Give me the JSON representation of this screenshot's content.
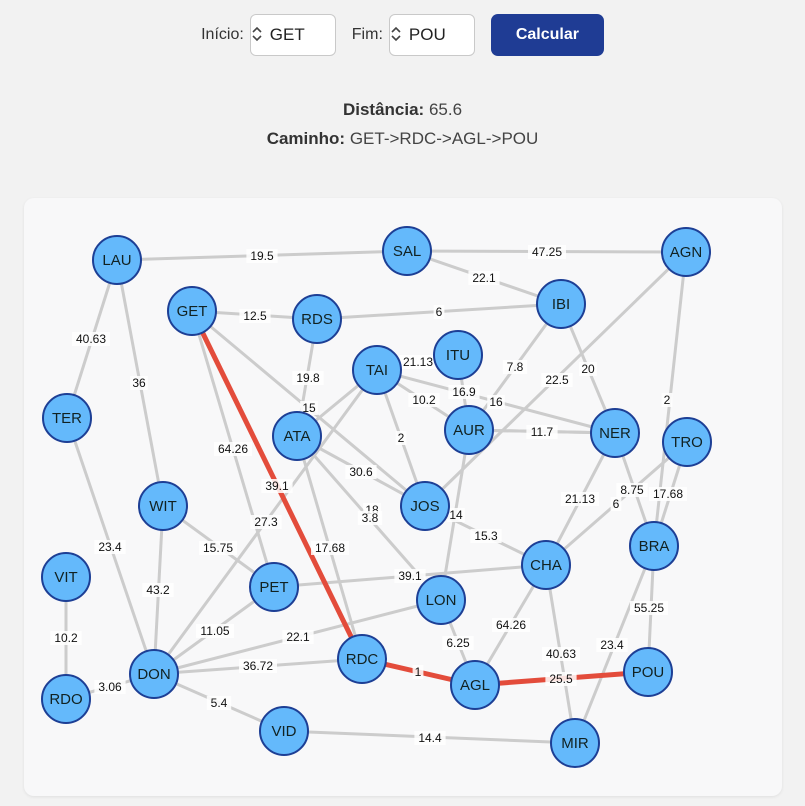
{
  "controls": {
    "start_label": "Início:",
    "start_value": "GET",
    "end_label": "Fim:",
    "end_value": "POU",
    "calc_button": "Calcular"
  },
  "result": {
    "distance_label": "Distância:",
    "distance_value": "65.6",
    "path_label": "Caminho:",
    "path_value": "GET->RDC->AGL->POU"
  },
  "graph": {
    "colors": {
      "node_fill": "#64b9fb",
      "node_stroke": "#1d3f95",
      "edge": "#cccccc",
      "path_edge": "#e34c3b",
      "button": "#1f3c94"
    },
    "nodes": [
      "LAU",
      "SAL",
      "AGN",
      "GET",
      "RDS",
      "IBI",
      "TAI",
      "ITU",
      "TER",
      "ATA",
      "AUR",
      "NER",
      "TRO",
      "WIT",
      "JOS",
      "BRA",
      "VIT",
      "CHA",
      "PET",
      "LON",
      "RDC",
      "AGL",
      "POU",
      "DON",
      "RDO",
      "VID",
      "MIR"
    ],
    "edges": [
      {
        "from": "LAU",
        "to": "SAL",
        "weight": "19.5"
      },
      {
        "from": "SAL",
        "to": "AGN",
        "weight": "47.25"
      },
      {
        "from": "SAL",
        "to": "IBI",
        "weight": "22.1"
      },
      {
        "from": "GET",
        "to": "RDS",
        "weight": "12.5"
      },
      {
        "from": "RDS",
        "to": "IBI",
        "weight": "6"
      },
      {
        "from": "LAU",
        "to": "TER",
        "weight": "40.63"
      },
      {
        "from": "LAU",
        "to": "WIT",
        "weight": "36"
      },
      {
        "from": "TER",
        "to": "DON",
        "weight": "23.4"
      },
      {
        "from": "VIT",
        "to": "RDO",
        "weight": "10.2"
      },
      {
        "from": "RDO",
        "to": "DON",
        "weight": "3.06"
      },
      {
        "from": "WIT",
        "to": "DON",
        "weight": "43.2"
      },
      {
        "from": "WIT",
        "to": "PET",
        "weight": "15.75"
      },
      {
        "from": "GET",
        "to": "PET",
        "weight": "64.26"
      },
      {
        "from": "GET",
        "to": "RDC",
        "weight": "39.1",
        "path": true
      },
      {
        "from": "GET",
        "to": "JOS",
        "weight": "18"
      },
      {
        "from": "RDS",
        "to": "ATA",
        "weight": "19.8"
      },
      {
        "from": "ATA",
        "to": "RDC",
        "weight": "17.68"
      },
      {
        "from": "ATA",
        "to": "JOS",
        "weight": "30.6"
      },
      {
        "from": "ATA",
        "to": "LON",
        "weight": "3.8"
      },
      {
        "from": "TAI",
        "to": "ATA",
        "weight": "15"
      },
      {
        "from": "TAI",
        "to": "JOS",
        "weight": "2"
      },
      {
        "from": "TAI",
        "to": "AUR",
        "weight": "10.2"
      },
      {
        "from": "TAI",
        "to": "NER",
        "weight": "16"
      },
      {
        "from": "TAI",
        "to": "DON",
        "weight": "27.3"
      },
      {
        "from": "ITU",
        "to": "AUR",
        "weight": "21.13"
      },
      {
        "from": "IBI",
        "to": "AUR",
        "weight": "7.8"
      },
      {
        "from": "IBI",
        "to": "NER",
        "weight": "20"
      },
      {
        "from": "AGN",
        "to": "JOS",
        "weight": "22.5"
      },
      {
        "from": "AGN",
        "to": "BRA",
        "weight": "2"
      },
      {
        "from": "AUR",
        "to": "NER",
        "weight": "11.7"
      },
      {
        "from": "AUR",
        "to": "LON",
        "weight": "14"
      },
      {
        "from": "NER",
        "to": "CHA",
        "weight": "21.13"
      },
      {
        "from": "NER",
        "to": "BRA",
        "weight": "8.75"
      },
      {
        "from": "TRO",
        "to": "CHA",
        "weight": "6"
      },
      {
        "from": "TRO",
        "to": "BRA",
        "weight": "17.68"
      },
      {
        "from": "JOS",
        "to": "CHA",
        "weight": "15.3"
      },
      {
        "from": "PET",
        "to": "CHA",
        "weight": "39.1"
      },
      {
        "from": "PET",
        "to": "DON",
        "weight": "11.05"
      },
      {
        "from": "LON",
        "to": "AGL",
        "weight": "6.25"
      },
      {
        "from": "LON",
        "to": "DON",
        "weight": "22.1"
      },
      {
        "from": "CHA",
        "to": "AGL",
        "weight": "64.26"
      },
      {
        "from": "CHA",
        "to": "MIR",
        "weight": "40.63"
      },
      {
        "from": "BRA",
        "to": "POU",
        "weight": "55.25"
      },
      {
        "from": "BRA",
        "to": "MIR",
        "weight": "23.4"
      },
      {
        "from": "RDC",
        "to": "DON",
        "weight": "36.72"
      },
      {
        "from": "RDC",
        "to": "AGL",
        "weight": "1",
        "path": true
      },
      {
        "from": "AGL",
        "to": "POU",
        "weight": "25.5",
        "path": true
      },
      {
        "from": "DON",
        "to": "VID",
        "weight": "5.4"
      },
      {
        "from": "VID",
        "to": "MIR",
        "weight": "14.4"
      },
      {
        "from": "NER",
        "to": "AUR",
        "weight": "16.9"
      }
    ]
  }
}
